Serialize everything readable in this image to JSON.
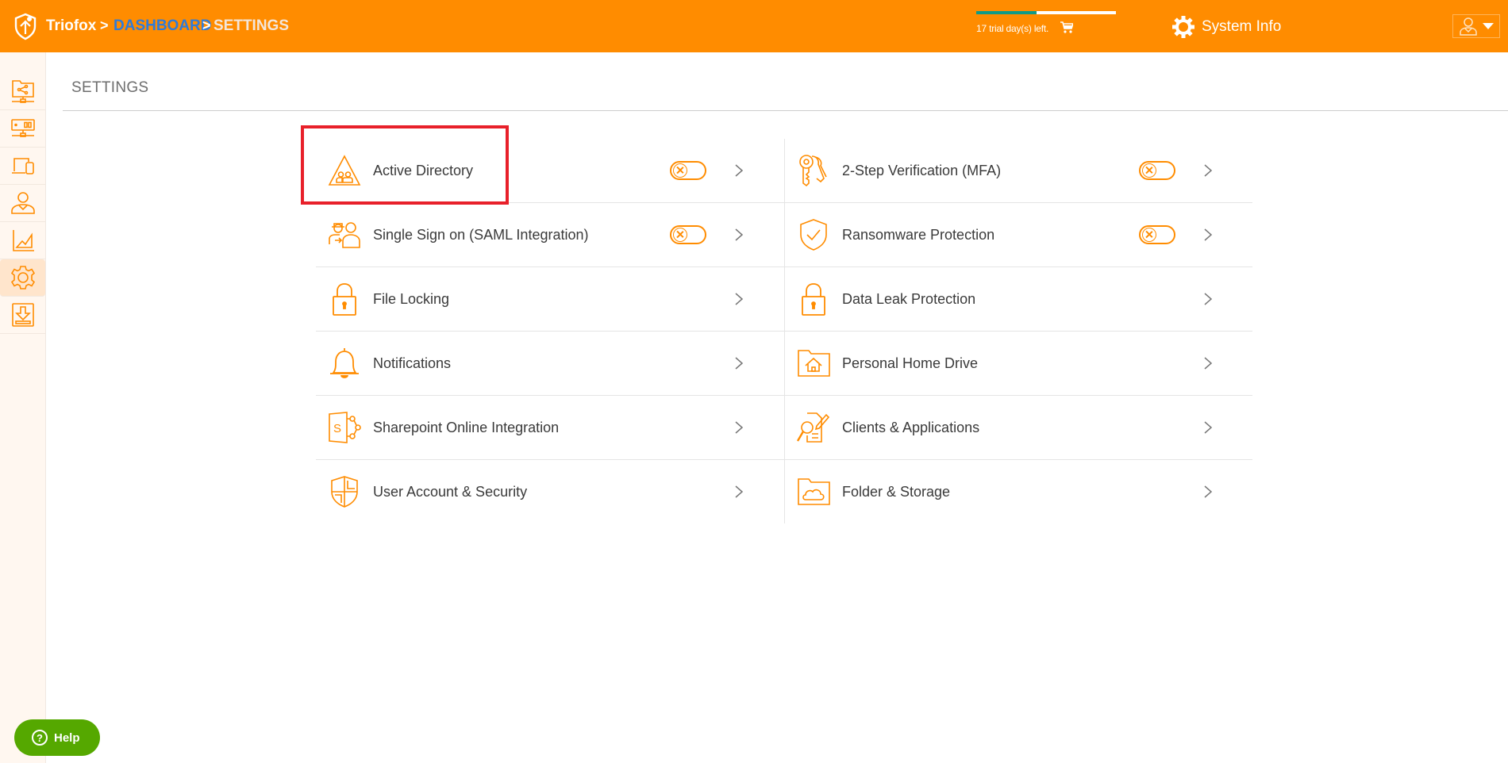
{
  "header": {
    "brand": "Triofox",
    "breadcrumb_sep": ">",
    "breadcrumb": [
      "DASHBOARD",
      "SETTINGS"
    ],
    "trial": {
      "text": "17 trial day(s) left.",
      "progress_fraction": 0.43
    },
    "system_info_label": "System Info",
    "colors": {
      "bar": "#FF8C00",
      "link": "#2F7BD9",
      "progress": "#119A86"
    }
  },
  "sidebar": {
    "items": [
      {
        "icon": "shared-folder-network-icon"
      },
      {
        "icon": "server-network-icon"
      },
      {
        "icon": "devices-icon"
      },
      {
        "icon": "user-icon"
      },
      {
        "icon": "chart-icon"
      },
      {
        "icon": "gear-icon",
        "active": true
      },
      {
        "icon": "download-icon"
      }
    ]
  },
  "page": {
    "title": "SETTINGS"
  },
  "settings": {
    "left": [
      {
        "label": "Active Directory",
        "icon": "active-directory-icon",
        "toggle": "off"
      },
      {
        "label": "Single Sign on (SAML Integration)",
        "icon": "sso-icon",
        "toggle": "off"
      },
      {
        "label": "File Locking",
        "icon": "lock-icon"
      },
      {
        "label": "Notifications",
        "icon": "bell-icon"
      },
      {
        "label": "Sharepoint Online Integration",
        "icon": "sharepoint-icon"
      },
      {
        "label": "User Account & Security",
        "icon": "shield-grid-icon"
      }
    ],
    "right": [
      {
        "label": "2-Step Verification (MFA)",
        "icon": "keys-icon",
        "toggle": "off"
      },
      {
        "label": "Ransomware Protection",
        "icon": "shield-check-icon",
        "toggle": "off"
      },
      {
        "label": "Data Leak Protection",
        "icon": "lock-icon"
      },
      {
        "label": "Personal Home Drive",
        "icon": "home-folder-icon"
      },
      {
        "label": "Clients & Applications",
        "icon": "clients-apps-icon"
      },
      {
        "label": "Folder & Storage",
        "icon": "cloud-folder-icon"
      }
    ],
    "highlighted": "Active Directory"
  },
  "help": {
    "label": "Help"
  }
}
